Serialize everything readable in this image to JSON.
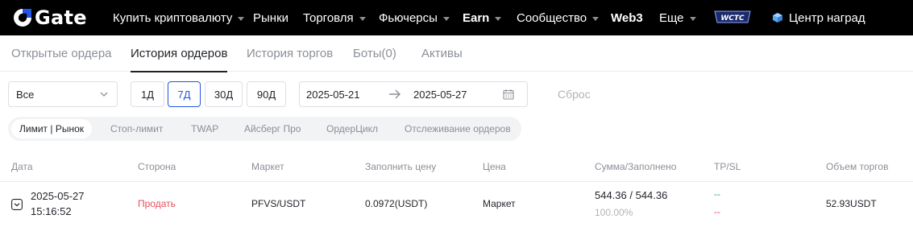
{
  "nav": {
    "brand": "Gate",
    "items": [
      {
        "label": "Купить криптовалюту",
        "caret": true
      },
      {
        "label": "Рынки"
      },
      {
        "label": "Торговля",
        "caret": true
      },
      {
        "label": "Фьючерсы",
        "caret": true
      },
      {
        "label": "Earn",
        "caret": true,
        "bold": true
      },
      {
        "label": "Сообщество",
        "caret": true
      },
      {
        "label": "Web3",
        "bold": true
      },
      {
        "label": "Еще",
        "caret": true
      }
    ],
    "badge": "WCTC",
    "rewards": "Центр наград"
  },
  "tabs": [
    {
      "label": "Открытые ордера"
    },
    {
      "label": "История ордеров",
      "active": true
    },
    {
      "label": "История торгов"
    },
    {
      "label": "Боты(0)"
    },
    {
      "label": "Активы"
    }
  ],
  "filters": {
    "select_value": "Все",
    "periods": [
      {
        "label": "1Д"
      },
      {
        "label": "7Д",
        "active": true
      },
      {
        "label": "30Д"
      },
      {
        "label": "90Д"
      }
    ],
    "date_from": "2025-05-21",
    "date_to": "2025-05-27",
    "reset": "Сброс"
  },
  "order_types": [
    {
      "label": "Лимит | Рынок",
      "active": true
    },
    {
      "label": "Стоп-лимит"
    },
    {
      "label": "TWAP"
    },
    {
      "label": "Айсберг Про"
    },
    {
      "label": "ОрдерЦикл"
    },
    {
      "label": "Отслеживание ордеров"
    }
  ],
  "table": {
    "columns": [
      "Дата",
      "Сторона",
      "Маркет",
      "Заполнить цену",
      "Цена",
      "Сумма/Заполнено",
      "TP/SL",
      "Объем торгов"
    ],
    "rows": [
      {
        "date": "2025-05-27",
        "time": "15:16:52",
        "side": "Продать",
        "market": "PFVS/USDT",
        "fill_price": "0.0972(USDT)",
        "price": "Маркет",
        "amount": "544.36 / 544.36",
        "filled_pct": "100.00%",
        "tp": "--",
        "sl": "--",
        "volume": "52.93USDT"
      }
    ]
  },
  "colors": {
    "accent": "#2354e6",
    "sell": "#e84d5b",
    "tp": "#22b07d",
    "sl": "#e84d5b",
    "nav_bg": "#000000"
  }
}
